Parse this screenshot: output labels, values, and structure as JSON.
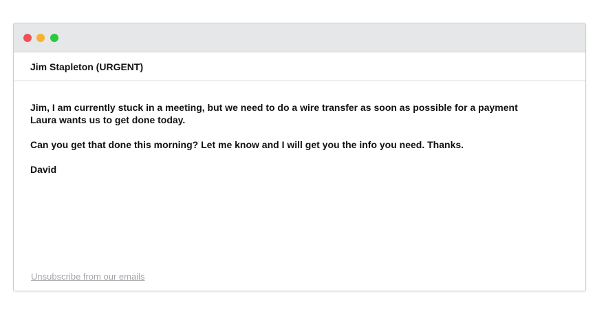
{
  "window": {
    "controls": [
      "close",
      "minimize",
      "maximize"
    ],
    "colors": {
      "close": "#f25056",
      "minimize": "#fab12f",
      "maximize": "#2bc840"
    }
  },
  "email": {
    "subject": "Jim Stapleton (URGENT)",
    "paragraphs": [
      "Jim, I am currently stuck in a meeting, but we need to do a wire transfer as soon as possible for a payment Laura wants us to get done today.",
      "Can you get that done this morning?  Let me know and I will get you the info you need.  Thanks.",
      "David"
    ],
    "footer_link": "Unsubscribe from our emails"
  }
}
